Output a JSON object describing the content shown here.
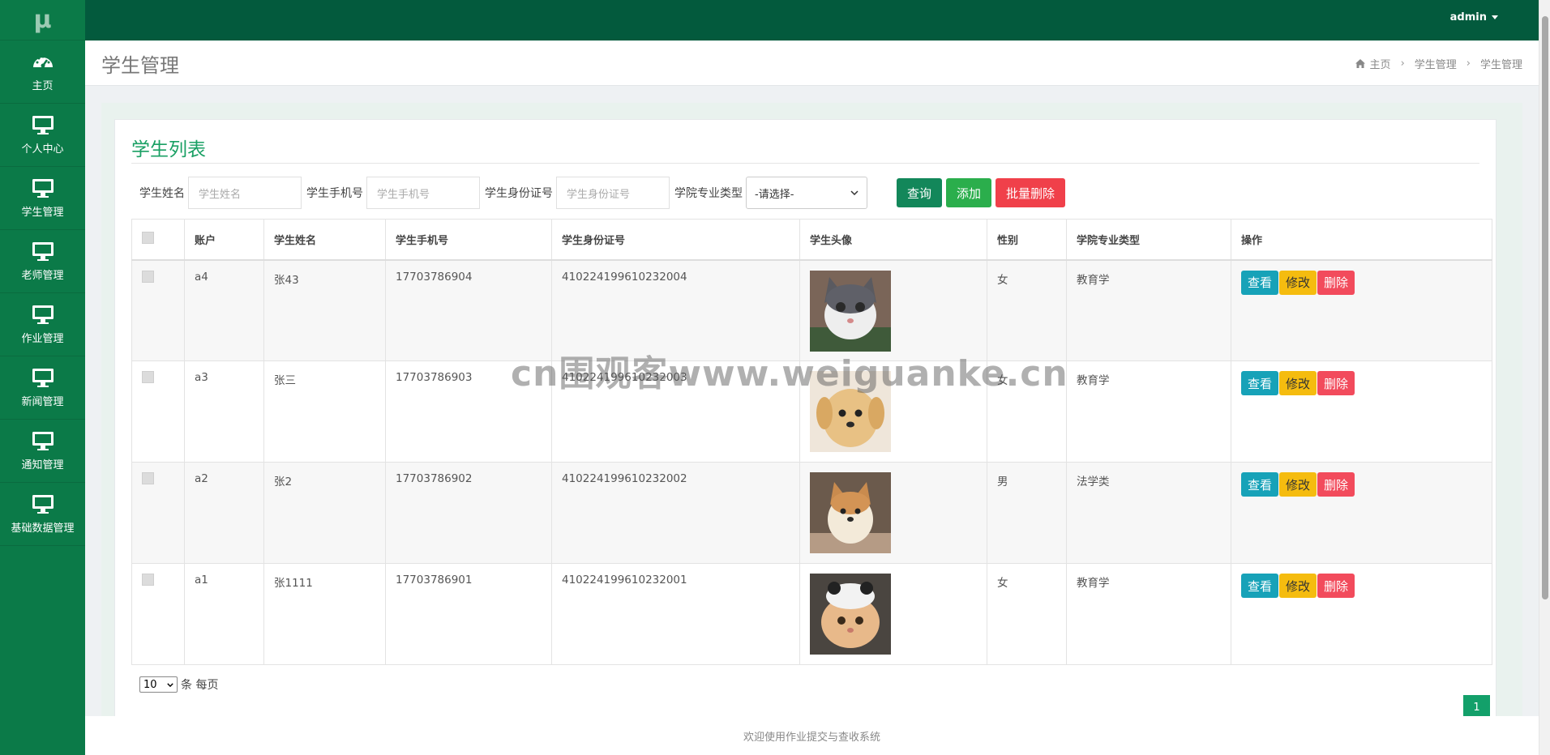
{
  "logo": "μ",
  "sidebar": {
    "items": [
      {
        "label": "主页",
        "icon": "dashboard-icon"
      },
      {
        "label": "个人中心",
        "icon": "monitor-icon"
      },
      {
        "label": "学生管理",
        "icon": "monitor-icon"
      },
      {
        "label": "老师管理",
        "icon": "monitor-icon"
      },
      {
        "label": "作业管理",
        "icon": "monitor-icon"
      },
      {
        "label": "新闻管理",
        "icon": "monitor-icon"
      },
      {
        "label": "通知管理",
        "icon": "monitor-icon"
      },
      {
        "label": "基础数据管理",
        "icon": "monitor-icon"
      }
    ]
  },
  "topbar": {
    "user": "admin"
  },
  "header": {
    "title": "学生管理",
    "breadcrumb": [
      "主页",
      "学生管理",
      "学生管理"
    ]
  },
  "card": {
    "title": "学生列表"
  },
  "search": {
    "name_label": "学生姓名",
    "name_placeholder": "学生姓名",
    "phone_label": "学生手机号",
    "phone_placeholder": "学生手机号",
    "id_label": "学生身份证号",
    "id_placeholder": "学生身份证号",
    "major_label": "学院专业类型",
    "major_selected": "-请选择-",
    "query_btn": "查询",
    "add_btn": "添加",
    "batch_delete_btn": "批量删除"
  },
  "table": {
    "columns": [
      "账户",
      "学生姓名",
      "学生手机号",
      "学生身份证号",
      "学生头像",
      "性别",
      "学院专业类型",
      "操作"
    ],
    "rows": [
      {
        "account": "a4",
        "name": "张43",
        "phone": "17703786904",
        "idcard": "410224199610232004",
        "gender": "女",
        "major": "教育学"
      },
      {
        "account": "a3",
        "name": "张三",
        "phone": "17703786903",
        "idcard": "410224199610232003",
        "gender": "女",
        "major": "教育学"
      },
      {
        "account": "a2",
        "name": "张2",
        "phone": "17703786902",
        "idcard": "410224199610232002",
        "gender": "男",
        "major": "法学类"
      },
      {
        "account": "a1",
        "name": "张1111",
        "phone": "17703786901",
        "idcard": "410224199610232001",
        "gender": "女",
        "major": "教育学"
      }
    ],
    "actions": {
      "view": "查看",
      "edit": "修改",
      "delete": "删除"
    }
  },
  "pager": {
    "page_size": "10",
    "page_size_suffix": "条 每页",
    "current_page": "1"
  },
  "footer": "欢迎使用作业提交与查收系统",
  "watermark": "cn围观客www.weiguanke.cn",
  "colors": {
    "sidebar": "#0b7a48",
    "topbar": "#035a3d",
    "accent": "#1aa064"
  }
}
